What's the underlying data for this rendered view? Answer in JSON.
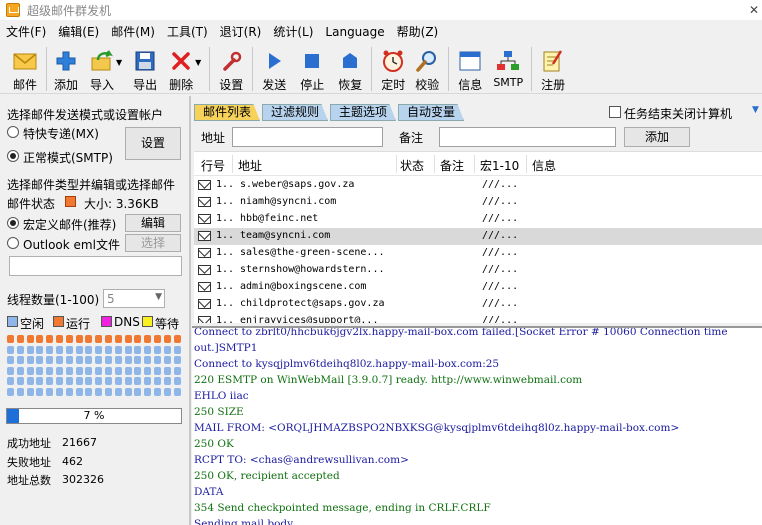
{
  "title": "超级邮件群发机",
  "menu": [
    "文件(F)",
    "编辑(E)",
    "邮件(M)",
    "工具(T)",
    "退订(R)",
    "统计(L)",
    "Language",
    "帮助(Z)"
  ],
  "toolbar": {
    "mail": "邮件",
    "add": "添加",
    "import": "导入",
    "export": "导出",
    "delete": "删除",
    "settings": "设置",
    "send": "发送",
    "stop": "停止",
    "resume": "恢复",
    "timer": "定时",
    "verify": "校验",
    "info": "信息",
    "smtp": "SMTP",
    "register": "注册"
  },
  "left": {
    "mode_heading": "选择邮件发送模式或设置帐户",
    "mode_fast": "特快专递(MX)",
    "mode_normal": "正常模式(SMTP)",
    "mode_settings_btn": "设置",
    "type_heading": "选择邮件类型并编辑或选择邮件",
    "mail_status_label": "邮件状态",
    "size_label": "大小: 3.36KB",
    "macro_mail": "宏定义邮件(推荐)",
    "edit_btn": "编辑",
    "outlook_eml": "Outlook eml文件",
    "select_btn": "选择",
    "eml_path": "",
    "threads_label": "线程数量(1-100)",
    "threads_value": "5",
    "legend": [
      {
        "label": "空闲",
        "color": "#8fb6e8"
      },
      {
        "label": "运行",
        "color": "#f07830"
      },
      {
        "label": "DNS",
        "color": "#f020e0"
      },
      {
        "label": "等待",
        "color": "#f8f020"
      }
    ],
    "progress_value": 0.07,
    "progress_text": "7 %",
    "stats": [
      {
        "label": "成功地址",
        "value": "21667"
      },
      {
        "label": "失败地址",
        "value": "462"
      },
      {
        "label": "地址总数",
        "value": "302326"
      }
    ]
  },
  "tabs": [
    "邮件列表",
    "过滤规则",
    "主题选项",
    "自动变量"
  ],
  "shutdown_label": "任务结束关闭计算机",
  "address_label": "地址",
  "address_value": "",
  "note_label": "备注",
  "note_value": "",
  "add_btn": "添加",
  "columns": [
    "行号",
    "地址",
    "状态",
    "备注",
    "宏1-10",
    "信息"
  ],
  "rows": [
    {
      "num": "1..",
      "addr": "s.weber@saps.gov.za",
      "macro": "///..."
    },
    {
      "num": "1..",
      "addr": "niamh@syncni.com",
      "macro": "///..."
    },
    {
      "num": "1..",
      "addr": "hbb@feinc.net",
      "macro": "///..."
    },
    {
      "num": "1..",
      "addr": "team@syncni.com",
      "macro": "///...",
      "selected": true
    },
    {
      "num": "1..",
      "addr": "sales@the-green-scene...",
      "macro": "///..."
    },
    {
      "num": "1..",
      "addr": "sternshow@howardstern...",
      "macro": "///..."
    },
    {
      "num": "1..",
      "addr": "admin@boxingscene.com",
      "macro": "///..."
    },
    {
      "num": "1..",
      "addr": "childprotect@saps.gov.za",
      "macro": "///..."
    },
    {
      "num": "1..",
      "addr": "enjrayvices@support@...",
      "macro": "///..."
    }
  ],
  "log": [
    {
      "text": "Connect to zbrlt0/hhcbuk6jgv2lx.happy-mail-box.com failed.[Socket Error # 10060 Connection time",
      "color": "#1a1aa0"
    },
    {
      "text": "out.]SMTP1",
      "color": "#1a1aa0"
    },
    {
      "text": "Connect to kysqjplmv6tdeihq8l0z.happy-mail-box.com:25",
      "color": "#1a1aa0"
    },
    {
      "text": "220 ESMTP on WinWebMail [3.9.0.7] ready.  http://www.winwebmail.com",
      "color": "#107010"
    },
    {
      "text": "EHLO iiac",
      "color": "#1a1aa0"
    },
    {
      "text": "250 SIZE",
      "color": "#107010"
    },
    {
      "text": "MAIL FROM: <ORQLJHMAZBSPO2NBXKSG@kysqjplmv6tdeihq8l0z.happy-mail-box.com>",
      "color": "#1a1aa0"
    },
    {
      "text": "250 OK",
      "color": "#107010"
    },
    {
      "text": "RCPT TO: <chas@andrewsullivan.com>",
      "color": "#1a1aa0"
    },
    {
      "text": "250 OK, recipient accepted",
      "color": "#107010"
    },
    {
      "text": "DATA",
      "color": "#1a1aa0"
    },
    {
      "text": "354 Send checkpointed message, ending in CRLF.CRLF",
      "color": "#107010"
    },
    {
      "text": "Sending mail body",
      "color": "#1a1aa0"
    }
  ]
}
